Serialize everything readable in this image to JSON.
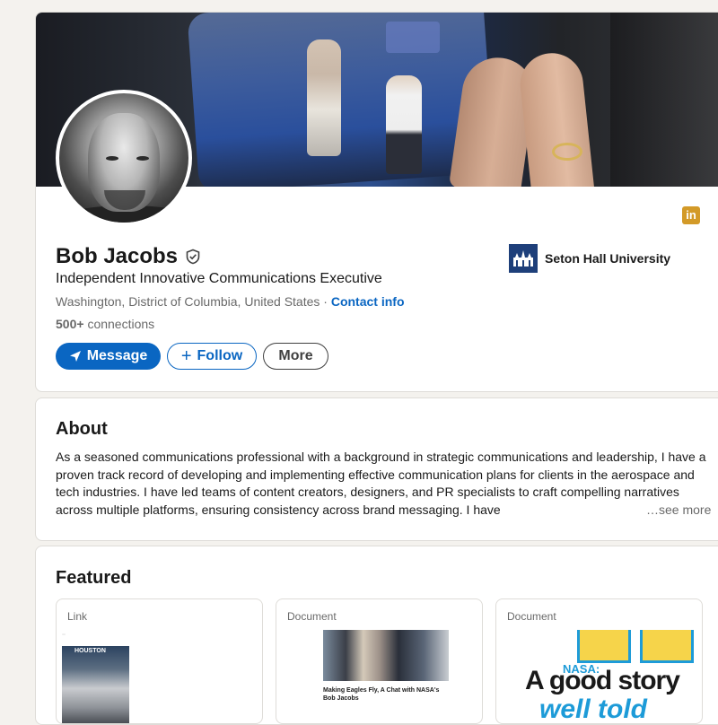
{
  "profile": {
    "name": "Bob Jacobs",
    "headline": "Independent Innovative Communications Executive",
    "location": "Washington, District of Columbia, United States",
    "separator": "·",
    "contact_info": "Contact info",
    "connections": "500+",
    "connections_suffix": "connections",
    "school": "Seton Hall University",
    "linkedin_badge": "in",
    "verified_icon": "shield-check-icon"
  },
  "actions": {
    "message": "Message",
    "follow": "Follow",
    "more": "More"
  },
  "about": {
    "title": "About",
    "text": "As a seasoned communications professional with a background in strategic communications and leadership, I have a proven track record of developing and implementing effective communication plans for clients in the aerospace and tech industries. I have led teams of content creators, designers, and PR specialists to craft compelling narratives across multiple platforms, ensuring consistency across brand messaging. I have",
    "see_more": "…see more"
  },
  "featured": {
    "title": "Featured",
    "items": [
      {
        "type": "Link",
        "thumb_text": "HOUSTON"
      },
      {
        "type": "Document",
        "caption": "Making Eagles Fly, A Chat with NASA's Bob Jacobs"
      },
      {
        "type": "Document",
        "small": "NASA:",
        "big": "A good story",
        "big2": "well told"
      }
    ]
  },
  "colors": {
    "primary": "#0a66c2",
    "page_bg": "#f4f2ee",
    "linkedin_badge": "#d39a28",
    "school_logo": "#1e3f7a"
  }
}
